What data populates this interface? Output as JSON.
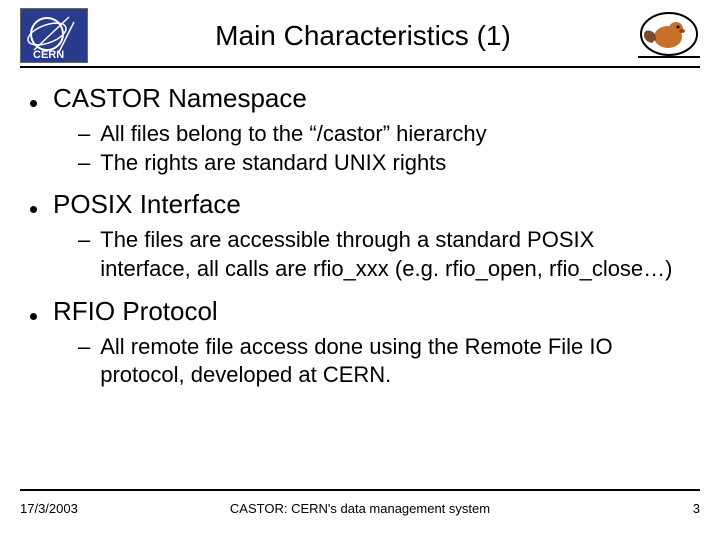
{
  "title": "Main Characteristics (1)",
  "bullets": [
    {
      "label": "CASTOR Namespace",
      "subs": [
        "All files belong to the “/castor” hierarchy",
        "The rights are standard UNIX rights"
      ]
    },
    {
      "label": "POSIX Interface",
      "subs": [
        "The files are accessible through a standard POSIX interface, all calls are rfio_xxx (e.g. rfio_open, rfio_close…)"
      ]
    },
    {
      "label": "RFIO Protocol",
      "subs": [
        "All remote file access done using the Remote File IO protocol, developed at CERN."
      ]
    }
  ],
  "footer": {
    "date": "17/3/2003",
    "caption": "CASTOR: CERN's data management system",
    "page": "3"
  }
}
